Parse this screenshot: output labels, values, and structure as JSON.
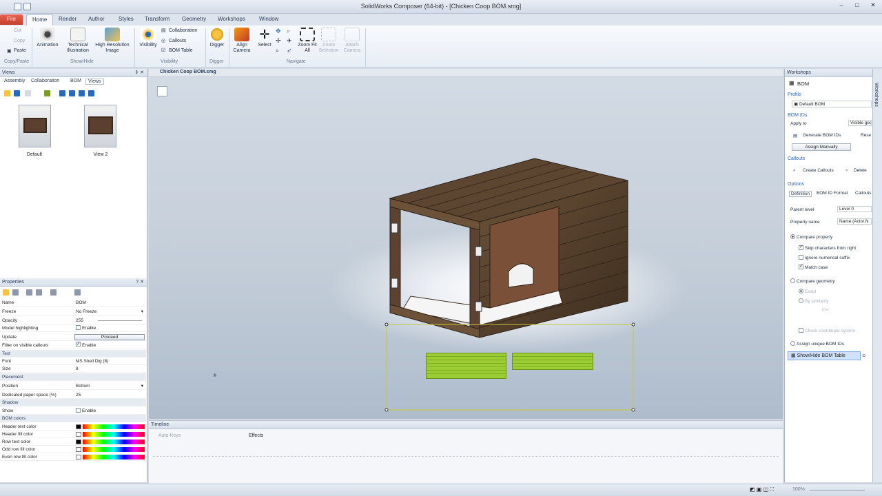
{
  "app": {
    "title": "SolidWorks Composer (64-bit) - [Chicken Coop BOM.smg]"
  },
  "ribbon_tabs": [
    "File",
    "Home",
    "Render",
    "Author",
    "Styles",
    "Transform",
    "Geometry",
    "Workshops",
    "Window"
  ],
  "ribbon": {
    "clipboard": {
      "cut": "Cut",
      "copy": "Copy",
      "paste": "Paste",
      "group": "Copy/Paste"
    },
    "showhide": {
      "animation": "Animation",
      "technical_illustration": "Technical Illustration",
      "high_res_image": "High Resolution Image",
      "group": "Show/Hide"
    },
    "visibility": {
      "visibility": "Visibility",
      "collaboration": "Collaboration",
      "callouts": "Callouts",
      "bom_table": "BOM Table",
      "group": "Visibility"
    },
    "digger": {
      "digger": "Digger",
      "group": "Digger"
    },
    "navigate": {
      "align_camera": "Align Camera",
      "select": "Select",
      "zoom_fit_all": "Zoom Fit All",
      "zoom_selection": "Zoom Selection",
      "attach_camera": "Attach Camera",
      "group": "Navigate"
    }
  },
  "views_panel": {
    "title": "Views",
    "tabs": [
      "Assembly",
      "Collaboration",
      "BOM",
      "Views"
    ],
    "active_tab": "Views",
    "thumbnails": [
      {
        "label": "Default"
      },
      {
        "label": "View 2"
      }
    ]
  },
  "properties_panel": {
    "title": "Properties",
    "rows": [
      {
        "k": "Name",
        "v": "BOM"
      },
      {
        "k": "Freeze",
        "v": "No Freeze"
      },
      {
        "k": "Opacity",
        "v": "255"
      },
      {
        "k": "Model highlighting",
        "v": "Enable"
      },
      {
        "k": "Update",
        "v": "Proceed"
      },
      {
        "k": "Filter on visible callouts",
        "v": "Enable"
      },
      {
        "k": "Text",
        "v": ""
      },
      {
        "k": "Font",
        "v": "MS Shell Dlg (8)"
      },
      {
        "k": "Size",
        "v": "8"
      },
      {
        "k": "Placement",
        "v": ""
      },
      {
        "k": "Position",
        "v": "Bottom"
      },
      {
        "k": "Dedicated paper space (%)",
        "v": "25"
      },
      {
        "k": "Shadow",
        "v": ""
      },
      {
        "k": "Show",
        "v": "Enable"
      },
      {
        "k": "BOM colors",
        "v": ""
      },
      {
        "k": "Header text color",
        "v": ""
      },
      {
        "k": "Header fill color",
        "v": ""
      },
      {
        "k": "Row text color",
        "v": ""
      },
      {
        "k": "Odd row fill color",
        "v": ""
      },
      {
        "k": "Even row fill color",
        "v": ""
      }
    ]
  },
  "document_tab": "Chicken Coop BOM.smg",
  "timeline": {
    "title": "Timeline",
    "auto_keys": "Auto-Keys",
    "effects": "Effects"
  },
  "workshops": {
    "title": "Workshops",
    "header": "BOM",
    "profile_label": "Profile",
    "profile_value": "Default BOM",
    "bom_ids_label": "BOM IDs",
    "apply_to": "Apply to",
    "apply_to_value": "Visible geo",
    "generate": "Generate BOM IDs",
    "reset": "Rese",
    "assign_manually": "Assign Manually",
    "callouts_label": "Callouts",
    "create_callouts": "Create Callouts",
    "delete": "Delete",
    "options_label": "Options",
    "option_tabs": [
      "Definition",
      "BOM ID Format",
      "Callouts"
    ],
    "parent_level": "Parent level",
    "parent_level_value": "Level 0",
    "property_name": "Property name",
    "property_name_value": "Name (Actor.N",
    "compare_property": "Compare property",
    "skip_chars": "Skip characters from right",
    "ignore_suffix": "Ignore numerical suffix",
    "match_case": "Match case",
    "compare_geometry": "Compare geometry",
    "exact": "Exact",
    "by_similarity": "By similarity",
    "low": "low",
    "check_coord": "Check coordinate system",
    "assign_unique": "Assign unique BOM IDs",
    "show_hide_bom": "Show/Hide BOM Table"
  },
  "side_strip": "Workshops",
  "status": {
    "zoom": "100%"
  },
  "colors": {
    "accent": "#e8614d",
    "bom_green": "#9acd32",
    "selection": "#c8c832"
  }
}
